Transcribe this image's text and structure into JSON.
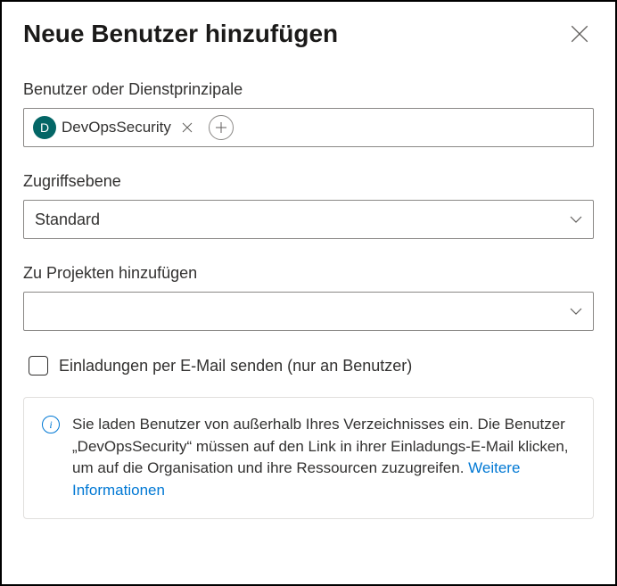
{
  "dialog": {
    "title": "Neue Benutzer hinzufügen"
  },
  "userField": {
    "label": "Benutzer oder Dienstprinzipale",
    "chip": {
      "initial": "D",
      "name": "DevOpsSecurity"
    }
  },
  "accessLevel": {
    "label": "Zugriffsebene",
    "selected": "Standard"
  },
  "projects": {
    "label": "Zu Projekten hinzufügen",
    "selected": ""
  },
  "emailInvite": {
    "label": "Einladungen per E-Mail senden (nur an Benutzer)"
  },
  "infoBox": {
    "text": "Sie laden Benutzer von außerhalb Ihres Verzeichnisses ein. Die Benutzer „DevOpsSecurity“ müssen auf den Link in ihrer Einladungs-E-Mail klicken, um auf die Organisation und ihre Ressourcen zuzugreifen. ",
    "linkText": "Weitere Informationen"
  }
}
